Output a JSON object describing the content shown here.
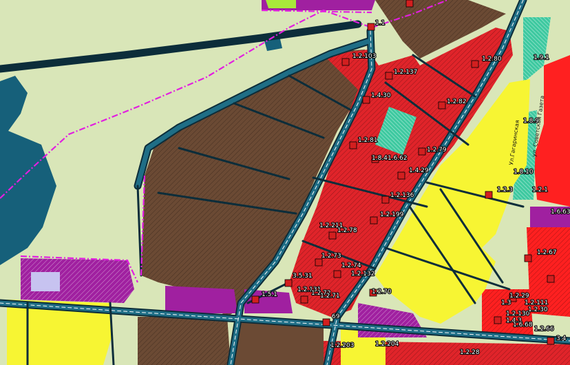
{
  "map": {
    "colors": {
      "water": "#16607a",
      "open_land": "#d9e6b8",
      "agricultural": "#6b4a34",
      "public_business": "#e0242a",
      "residential_low": "#f7f533",
      "residential_high": "#ff2020",
      "industrial": "#a020a0",
      "recreation": "#3ec9a0",
      "lavender": "#c7c3f0",
      "road_fill": "#1f6e86",
      "road_edge": "#0c2d3a",
      "boundary": "#e21fe0",
      "marker": "#d21f1f"
    },
    "streets": [
      {
        "id": "ul-gagarinskaya",
        "text": "Ул.Гагаринская"
      },
      {
        "id": "ul-soviet",
        "text": "ул. Советская Газета"
      }
    ],
    "zone_labels": [
      {
        "id": "z-1-1",
        "text": "1.1"
      },
      {
        "id": "z-1-2-103",
        "text": "1.2.103"
      },
      {
        "id": "z-1-2-80",
        "text": "1.2.80"
      },
      {
        "id": "z-1-2-137",
        "text": "1.2.137"
      },
      {
        "id": "z-1-4-30",
        "text": "1.4.30"
      },
      {
        "id": "z-1-2-82",
        "text": "1.2.82"
      },
      {
        "id": "z-1-2-81",
        "text": "1.2.81"
      },
      {
        "id": "z-1-8-4",
        "text": "1.8.4"
      },
      {
        "id": "z-1-6-62",
        "text": "1.6.62"
      },
      {
        "id": "z-1-2-79",
        "text": "1.2.79"
      },
      {
        "id": "z-1-4-29",
        "text": "1.4.29"
      },
      {
        "id": "z-1-2-136",
        "text": "1.2.136"
      },
      {
        "id": "z-1-2-199",
        "text": "1.2.199"
      },
      {
        "id": "z-1-2-211",
        "text": "1.2.211"
      },
      {
        "id": "z-1-2-78",
        "text": "1.2.78"
      },
      {
        "id": "z-1-2-73",
        "text": "1.2.73"
      },
      {
        "id": "z-1-2-74",
        "text": "1.2.74"
      },
      {
        "id": "z-1-2-132",
        "text": "1.2.132"
      },
      {
        "id": "z-3-5-31",
        "text": "3.5.31"
      },
      {
        "id": "z-1-2-131",
        "text": "1.2.131"
      },
      {
        "id": "z-1-2-72",
        "text": "1.2.72"
      },
      {
        "id": "z-1-2-71",
        "text": "1.2.71"
      },
      {
        "id": "z-1-2-70",
        "text": "1.2.70"
      },
      {
        "id": "z-1-5-1",
        "text": "1.5.1"
      },
      {
        "id": "z-69",
        "text": "69"
      },
      {
        "id": "z-1-2-203",
        "text": "1.2.203"
      },
      {
        "id": "z-1-2-204",
        "text": "1.2.204"
      },
      {
        "id": "z-1-2-28",
        "text": "1.2.28"
      },
      {
        "id": "z-1-2-29",
        "text": "1.2.29"
      },
      {
        "id": "z-1-3",
        "text": "1.3"
      },
      {
        "id": "z-1-2-130",
        "text": "1.2.130"
      },
      {
        "id": "z-1-2-111",
        "text": "1.2.111"
      },
      {
        "id": "z-1-2-30",
        "text": "1.2.30"
      },
      {
        "id": "z-1-4-3",
        "text": "1.4.3"
      },
      {
        "id": "z-1-6-68",
        "text": "1.6.68"
      },
      {
        "id": "z-1-2-66",
        "text": "1.2.66"
      },
      {
        "id": "z-1-2-67",
        "text": "1.2.67"
      },
      {
        "id": "z-3-4",
        "text": "3.4"
      },
      {
        "id": "z-1-6-63",
        "text": "1.6.63"
      },
      {
        "id": "z-1-2-3",
        "text": "1.2.3"
      },
      {
        "id": "z-1-8-10",
        "text": "1.8.10"
      },
      {
        "id": "z-1-8-9",
        "text": "1.8.9"
      },
      {
        "id": "z-1-9-1",
        "text": "1.9.1"
      },
      {
        "id": "z-1-2-1",
        "text": "1.2.1"
      }
    ]
  }
}
